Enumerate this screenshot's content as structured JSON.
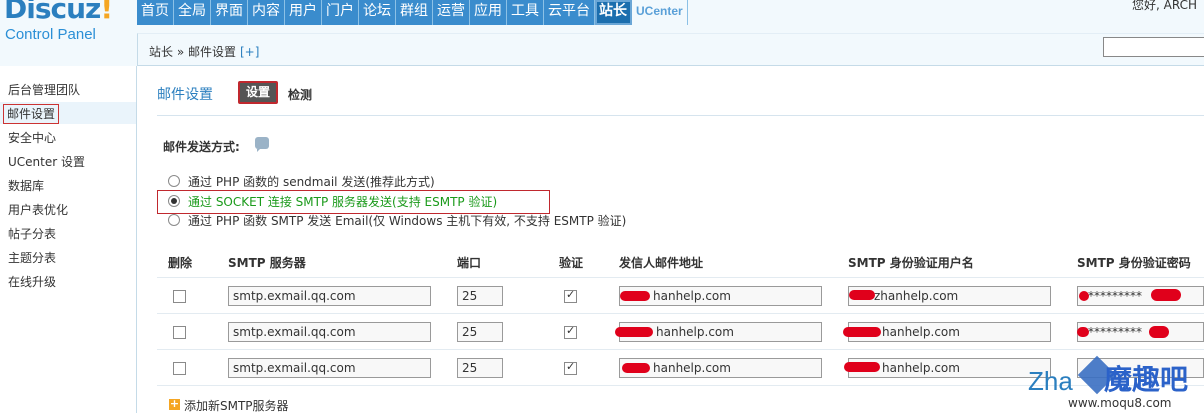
{
  "header": {
    "logo_main": "Discuz",
    "logo_bang": "!",
    "logo_sub": "Control Panel",
    "nav": [
      "首页",
      "全局",
      "界面",
      "内容",
      "用户",
      "门户",
      "论坛",
      "群组",
      "运营",
      "应用",
      "工具",
      "云平台",
      "站长",
      "UCenter"
    ],
    "greeting": "您好, ARCH"
  },
  "breadcrumb": {
    "text": "站长 » 邮件设置",
    "plus": "[+]"
  },
  "sidebar": {
    "items": [
      "后台管理团队",
      "邮件设置",
      "安全中心",
      "UCenter 设置",
      "数据库",
      "用户表优化",
      "帖子分表",
      "主题分表",
      "在线升级"
    ]
  },
  "content": {
    "title": "邮件设置",
    "tab_settings": "设置",
    "tab_check": "检测",
    "send_method_label": "邮件发送方式:",
    "options": [
      "通过 PHP 函数的 sendmail 发送(推荐此方式)",
      "通过 SOCKET 连接 SMTP 服务器发送(支持 ESMTP 验证)",
      "通过 PHP 函数 SMTP 发送 Email(仅 Windows 主机下有效, 不支持 ESMTP 验证)"
    ],
    "selected_option": 1,
    "table": {
      "headers": [
        "删除",
        "SMTP 服务器",
        "端口",
        "验证",
        "发信人邮件地址",
        "SMTP 身份验证用户名",
        "SMTP 身份验证密码"
      ],
      "rows": [
        {
          "server": "smtp.exmail.qq.com",
          "port": "25",
          "auth": true,
          "from": "hanhelp.com",
          "user": "zhanhelp.com",
          "pass": "*********"
        },
        {
          "server": "smtp.exmail.qq.com",
          "port": "25",
          "auth": true,
          "from": "hanhelp.com",
          "user": "hanhelp.com",
          "pass": "*********"
        },
        {
          "server": "smtp.exmail.qq.com",
          "port": "25",
          "auth": true,
          "from": "hanhelp.com",
          "user": "hanhelp.com",
          "pass": ""
        }
      ]
    },
    "add_server": "添加新SMTP服务器"
  },
  "watermark": {
    "left": "Zha",
    "logo": "魔趣吧",
    "url": "www.moqu8.com"
  },
  "colors": {
    "accent": "#2b7fbf",
    "nav_bg": "#3a8ccd",
    "highlight_red": "#c0282e",
    "redaction": "#e0001b"
  }
}
